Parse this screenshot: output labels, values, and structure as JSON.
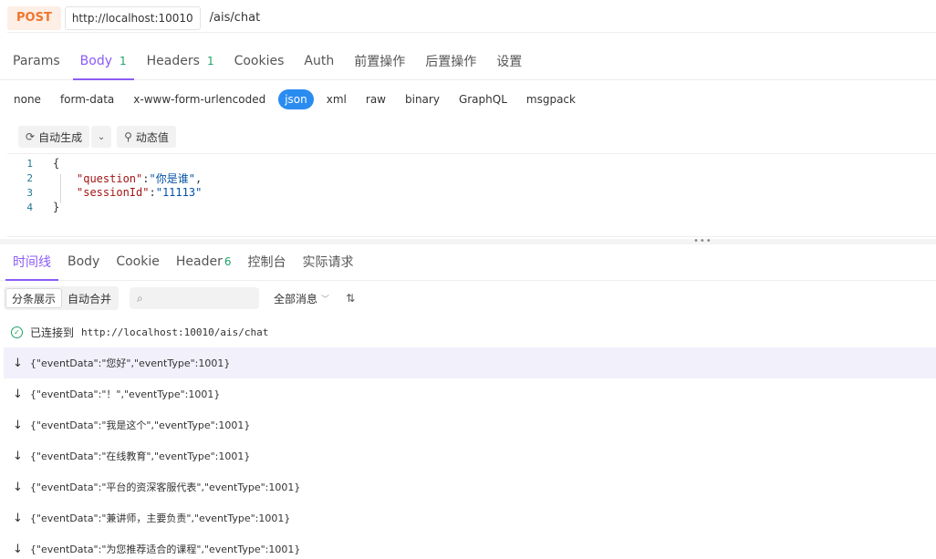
{
  "request": {
    "method": "POST",
    "host": "http://localhost:10010",
    "path": "/ais/chat"
  },
  "req_tabs": [
    {
      "label": "Params",
      "count": ""
    },
    {
      "label": "Body",
      "count": "1"
    },
    {
      "label": "Headers",
      "count": "1"
    },
    {
      "label": "Cookies",
      "count": ""
    },
    {
      "label": "Auth",
      "count": ""
    },
    {
      "label": "前置操作",
      "count": ""
    },
    {
      "label": "后置操作",
      "count": ""
    },
    {
      "label": "设置",
      "count": ""
    }
  ],
  "body_types": [
    "none",
    "form-data",
    "x-www-form-urlencoded",
    "json",
    "xml",
    "raw",
    "binary",
    "GraphQL",
    "msgpack"
  ],
  "tools": {
    "auto_generate": "自动生成",
    "dynamic_value": "动态值"
  },
  "editor": {
    "line_numbers": [
      "1",
      "2",
      "3",
      "4"
    ],
    "open_brace": "{",
    "close_brace": "}",
    "field1_key": "\"question\"",
    "field1_value": "\"你是谁\"",
    "field2_key": "\"sessionId\"",
    "field2_value": "\"11113\""
  },
  "res_tabs": [
    {
      "label": "时间线",
      "count": ""
    },
    {
      "label": "Body",
      "count": ""
    },
    {
      "label": "Cookie",
      "count": ""
    },
    {
      "label": "Header",
      "count": "6"
    },
    {
      "label": "控制台",
      "count": ""
    },
    {
      "label": "实际请求",
      "count": ""
    }
  ],
  "res_tools": {
    "split_view": "分条展示",
    "auto_merge": "自动合并",
    "search_placeholder": "",
    "filter": "全部消息"
  },
  "connection": {
    "status": "已连接到",
    "url": "http://localhost:10010/ais/chat"
  },
  "events": [
    "{\"eventData\":\"您好\",\"eventType\":1001}",
    "{\"eventData\":\"！\",\"eventType\":1001}",
    "{\"eventData\":\"我是这个\",\"eventType\":1001}",
    "{\"eventData\":\"在线教育\",\"eventType\":1001}",
    "{\"eventData\":\"平台的资深客服代表\",\"eventType\":1001}",
    "{\"eventData\":\"兼讲师，主要负责\",\"eventType\":1001}",
    "{\"eventData\":\"为您推荐适合的课程\",\"eventType\":1001}"
  ]
}
